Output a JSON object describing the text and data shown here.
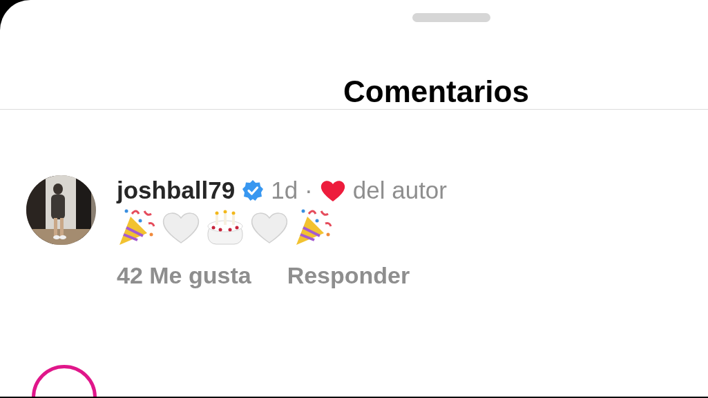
{
  "sheet": {
    "title": "Comentarios"
  },
  "comments": [
    {
      "username": "joshball79",
      "verified": true,
      "time": "1d",
      "separator": "·",
      "liked_by_author": true,
      "author_like_label": "del autor",
      "emojis": [
        {
          "kind": "party"
        },
        {
          "kind": "heart"
        },
        {
          "kind": "cake"
        },
        {
          "kind": "heart"
        },
        {
          "kind": "party"
        }
      ],
      "likes": "42 Me gusta",
      "reply": "Responder"
    }
  ]
}
